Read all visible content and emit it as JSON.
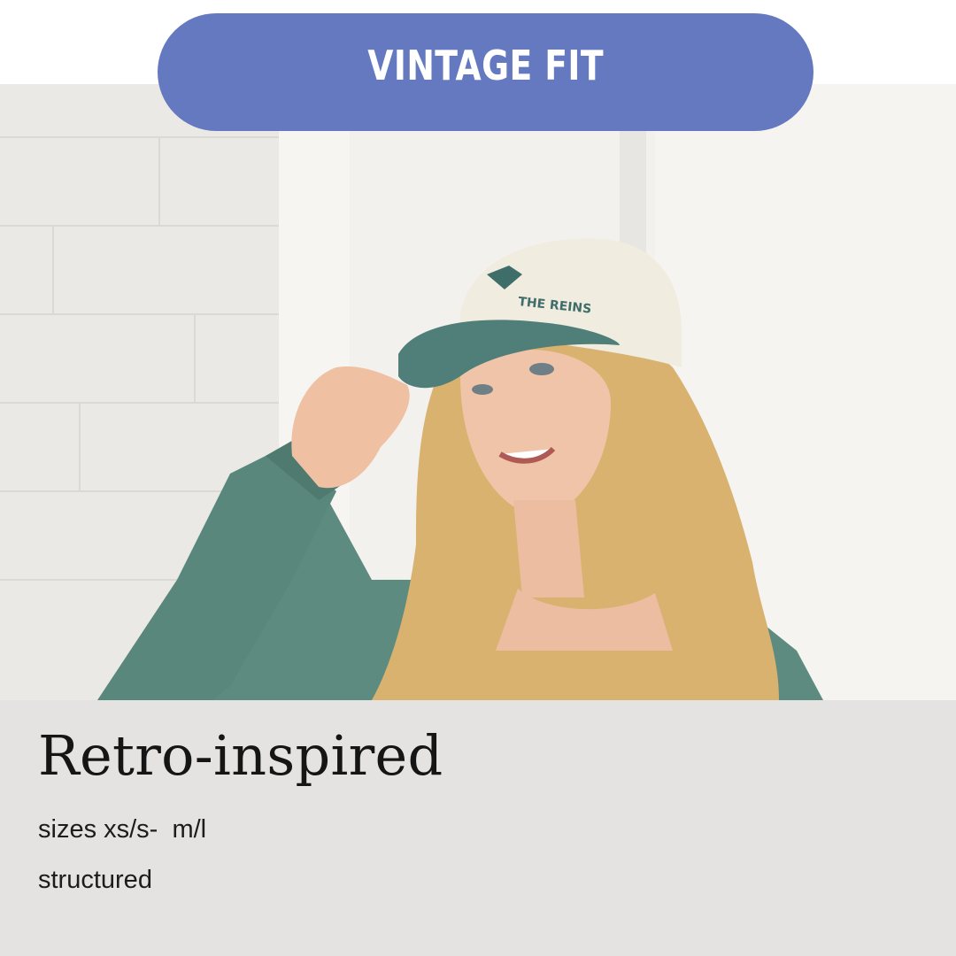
{
  "badge": {
    "label": "VINTAGE FIT"
  },
  "product": {
    "title": "Retro-inspired",
    "sizes": "sizes xs/s-  m/l",
    "structure": "structured"
  },
  "photo": {
    "subject": "smiling blonde woman in teal zip jacket touching a cream and teal structured cap",
    "cap_text": "THE REINS"
  },
  "colors": {
    "badge": "#6479bf",
    "info_panel": "#e4e3e2",
    "jacket": "#5d8b80",
    "cap_brim": "#4f7f78",
    "cap_crown": "#f1ece0",
    "hair": "#d9b270"
  }
}
